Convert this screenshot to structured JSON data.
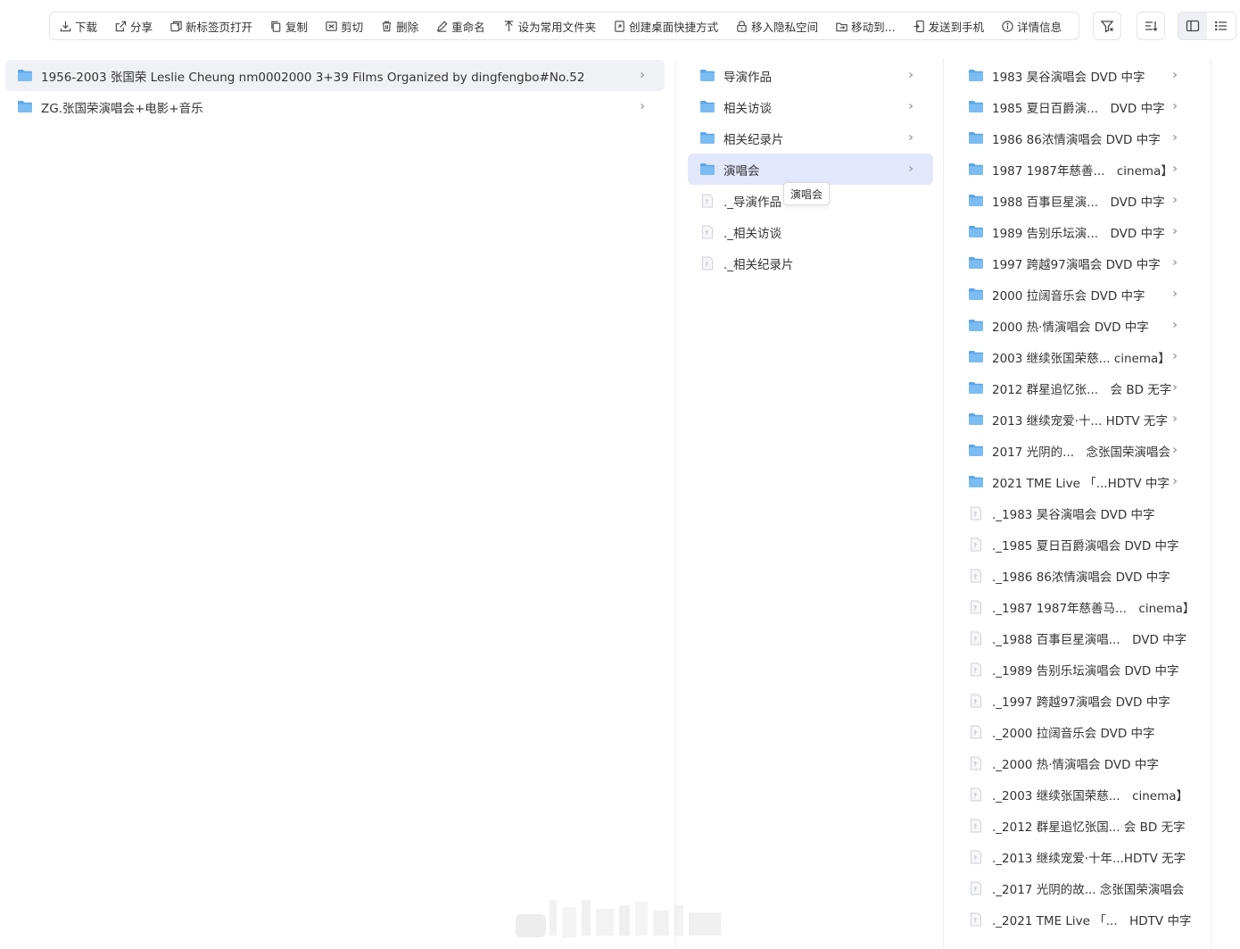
{
  "toolbar": {
    "buttons": [
      {
        "label": "下载",
        "icon": "download-icon"
      },
      {
        "label": "分享",
        "icon": "share-icon"
      },
      {
        "label": "新标签页打开",
        "icon": "new-tab-icon"
      },
      {
        "label": "复制",
        "icon": "copy-icon"
      },
      {
        "label": "剪切",
        "icon": "cut-icon"
      },
      {
        "label": "删除",
        "icon": "trash-icon"
      },
      {
        "label": "重命名",
        "icon": "pencil-icon"
      },
      {
        "label": "设为常用文件夹",
        "icon": "pin-icon"
      },
      {
        "label": "创建桌面快捷方式",
        "icon": "shortcut-icon"
      },
      {
        "label": "移入隐私空间",
        "icon": "lock-icon"
      },
      {
        "label": "移动到...",
        "icon": "move-icon"
      },
      {
        "label": "发送到手机",
        "icon": "phone-icon"
      },
      {
        "label": "详情信息",
        "icon": "info-icon"
      }
    ],
    "filter_icon": "filter-icon",
    "sort_icon": "sort-icon",
    "view_column_icon": "column-view-icon",
    "view_list_icon": "list-view-icon"
  },
  "columns": {
    "col1": [
      {
        "label": "1956-2003 张国荣 Leslie Cheung nm0002000 3+39 Films Organized by dingfengbo#No.52",
        "type": "folder",
        "selected": true
      },
      {
        "label": "ZG.张国荣演唱会+电影+音乐",
        "type": "folder",
        "selected": false
      }
    ],
    "col2": [
      {
        "label": "导演作品",
        "type": "folder"
      },
      {
        "label": "相关访谈",
        "type": "folder"
      },
      {
        "label": "相关纪录片",
        "type": "folder"
      },
      {
        "label": "演唱会",
        "type": "folder",
        "active": true
      },
      {
        "label": "._导演作品",
        "type": "file"
      },
      {
        "label": "._相关访谈",
        "type": "file"
      },
      {
        "label": "._相关纪录片",
        "type": "file"
      }
    ],
    "col3": [
      {
        "label": "1983 昊谷演唱会 DVD 中字",
        "type": "folder"
      },
      {
        "label": "1985 夏日百爵演...　DVD 中字",
        "type": "folder"
      },
      {
        "label": "1986 86浓情演唱会 DVD 中字",
        "type": "folder"
      },
      {
        "label": "1987 1987年慈善...　cinema】",
        "type": "folder"
      },
      {
        "label": "1988 百事巨星演...　DVD 中字",
        "type": "folder"
      },
      {
        "label": "1989 告别乐坛演...　DVD 中字",
        "type": "folder"
      },
      {
        "label": "1997 跨越97演唱会 DVD 中字",
        "type": "folder"
      },
      {
        "label": "2000 拉阔音乐会 DVD 中字",
        "type": "folder"
      },
      {
        "label": "2000 热·情演唱会 DVD 中字",
        "type": "folder"
      },
      {
        "label": "2003 继续张国荣慈... cinema】",
        "type": "folder"
      },
      {
        "label": "2012 群星追忆张...　会 BD 无字",
        "type": "folder"
      },
      {
        "label": "2013 继续宠爱·十... HDTV 无字",
        "type": "folder"
      },
      {
        "label": "2017 光阴的...　念张国荣演唱会",
        "type": "folder"
      },
      {
        "label": "2021 TME Live 「...HDTV 中字",
        "type": "folder"
      },
      {
        "label": "._1983 昊谷演唱会 DVD 中字",
        "type": "file"
      },
      {
        "label": "._1985 夏日百爵演唱会 DVD 中字",
        "type": "file"
      },
      {
        "label": "._1986 86浓情演唱会 DVD 中字",
        "type": "file"
      },
      {
        "label": "._1987 1987年慈善马...　cinema】",
        "type": "file"
      },
      {
        "label": "._1988 百事巨星演唱...　DVD 中字",
        "type": "file"
      },
      {
        "label": "._1989 告别乐坛演唱会 DVD 中字",
        "type": "file"
      },
      {
        "label": "._1997 跨越97演唱会 DVD 中字",
        "type": "file"
      },
      {
        "label": "._2000 拉阔音乐会 DVD 中字",
        "type": "file"
      },
      {
        "label": "._2000 热·情演唱会 DVD 中字",
        "type": "file"
      },
      {
        "label": "._2003 继续张国荣慈...　cinema】",
        "type": "file"
      },
      {
        "label": "._2012 群星追忆张国... 会 BD 无字",
        "type": "file"
      },
      {
        "label": "._2013 继续宠爱·十年...HDTV 无字",
        "type": "file"
      },
      {
        "label": "._2017 光阴的故... 念张国荣演唱会",
        "type": "file"
      },
      {
        "label": "._2021 TME Live 「...　HDTV 中字",
        "type": "file"
      }
    ]
  },
  "tooltip": {
    "text": "演唱会"
  },
  "colors": {
    "accent_active_bg": "#e3e7fb",
    "selected_bg": "#f0f1f4",
    "folder": "#6fb5ee"
  }
}
